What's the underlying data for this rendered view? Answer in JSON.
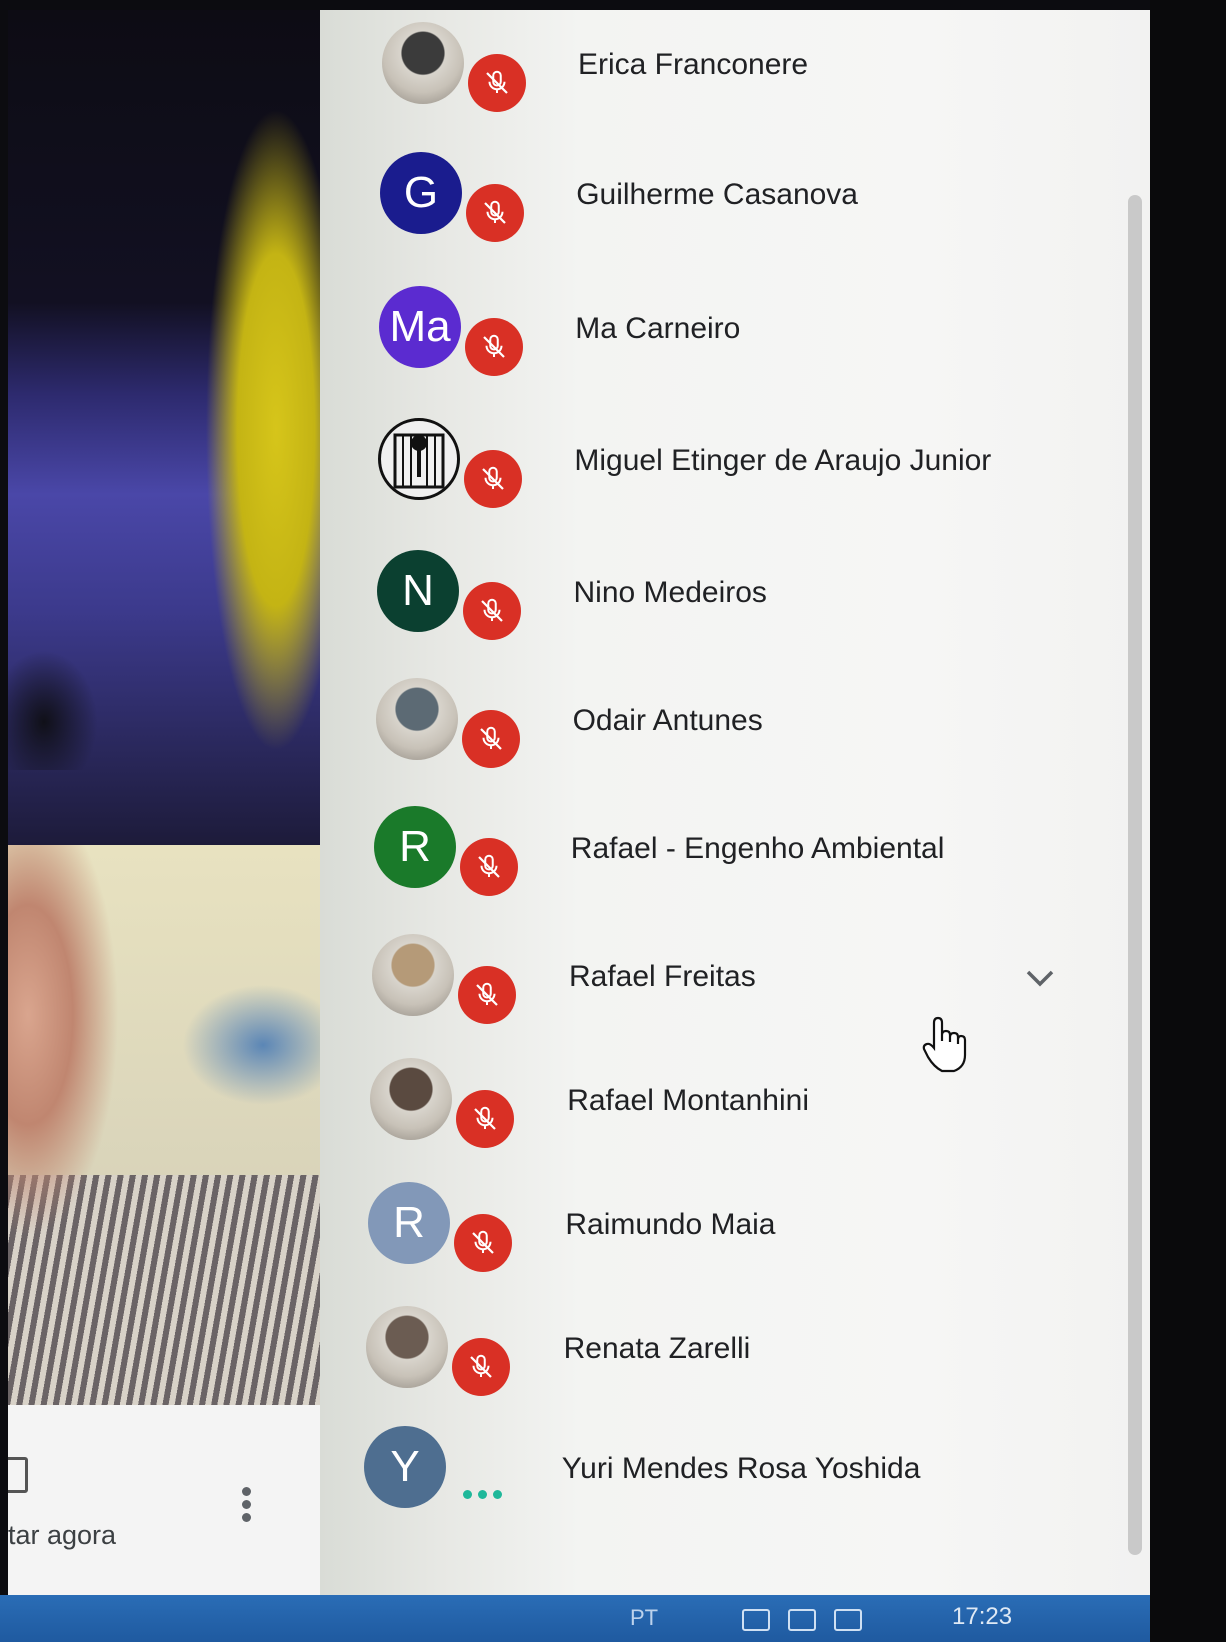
{
  "meeting": {
    "controls": {
      "present_label": "tar agora",
      "more_icon": "more-vert-icon",
      "present_icon": "present-screen-icon"
    }
  },
  "participants": [
    {
      "name": "Erica Franconere",
      "avatar": {
        "type": "photo",
        "initial": "",
        "color": "#3b3b3b"
      },
      "mic": "mic-off-icon"
    },
    {
      "name": "Guilherme Casanova",
      "avatar": {
        "type": "initial",
        "initial": "G",
        "color": "#1a1c8e"
      },
      "mic": "mic-off-icon"
    },
    {
      "name": "Ma Carneiro",
      "avatar": {
        "type": "initial",
        "initial": "Ma",
        "color": "#5b2bd0"
      },
      "mic": "mic-off-icon"
    },
    {
      "name": "Miguel Etinger de Araujo Junior",
      "avatar": {
        "type": "photo",
        "initial": "",
        "color": "#e8e8e8"
      },
      "mic": "mic-off-icon"
    },
    {
      "name": "Nino Medeiros",
      "avatar": {
        "type": "initial",
        "initial": "N",
        "color": "#0b4030"
      },
      "mic": "mic-off-icon"
    },
    {
      "name": "Odair Antunes",
      "avatar": {
        "type": "photo",
        "initial": "",
        "color": "#5c6a74"
      },
      "mic": "mic-off-icon"
    },
    {
      "name": "Rafael - Engenho Ambiental",
      "avatar": {
        "type": "initial",
        "initial": "R",
        "color": "#1a7a2a"
      },
      "mic": "mic-off-icon"
    },
    {
      "name": "Rafael Freitas",
      "avatar": {
        "type": "photo",
        "initial": "",
        "color": "#b59a78"
      },
      "mic": "mic-off-icon",
      "expand": "chevron-down-icon"
    },
    {
      "name": "Rafael Montanhini",
      "avatar": {
        "type": "photo",
        "initial": "",
        "color": "#5a4a40"
      },
      "mic": "mic-off-icon"
    },
    {
      "name": "Raimundo Maia",
      "avatar": {
        "type": "initial",
        "initial": "R",
        "color": "#8298b8"
      },
      "mic": "mic-off-icon"
    },
    {
      "name": "Renata Zarelli",
      "avatar": {
        "type": "photo",
        "initial": "",
        "color": "#6b5c52"
      },
      "mic": "mic-off-icon"
    },
    {
      "name": "Yuri Mendes Rosa Yoshida",
      "avatar": {
        "type": "initial",
        "initial": "Y",
        "color": "#4e6e90"
      },
      "mic": "speaking-dots-icon"
    }
  ],
  "taskbar": {
    "label": "PT",
    "clock": "17:23"
  },
  "colors": {
    "mic_off_bg": "#d93025",
    "speaking_dots": "#1fb89a"
  }
}
